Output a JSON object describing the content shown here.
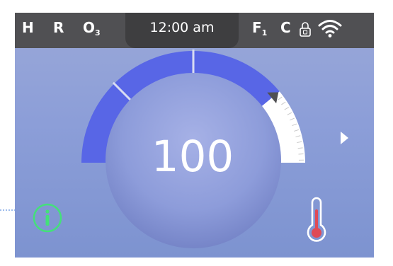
{
  "status_bar": {
    "left_indicators": [
      {
        "label": "H"
      },
      {
        "label": "R"
      },
      {
        "label": "O",
        "sub": "3"
      }
    ],
    "clock": "12:00 am",
    "right_indicators": [
      {
        "label": "F",
        "sub": "1"
      },
      {
        "label": "C"
      }
    ],
    "icons": [
      "lock-icon",
      "wifi-icon"
    ]
  },
  "gauge": {
    "setpoint": "100",
    "level_fraction": 0.78,
    "segment_color": "#5866e6",
    "inactive_color": "#ffffff",
    "divider_color": "#d8dcf2"
  },
  "buttons": {
    "info_icon": "info-icon",
    "next_icon": "chevron-right-icon"
  },
  "indicators": {
    "temperature_icon": "thermometer-icon",
    "thermometer_color": "#e04a56"
  },
  "colors": {
    "status_bar": "#505053",
    "screen_background": "#8c9ed8",
    "info_green": "#44e07a",
    "callout_blue": "#3b7ad8"
  }
}
